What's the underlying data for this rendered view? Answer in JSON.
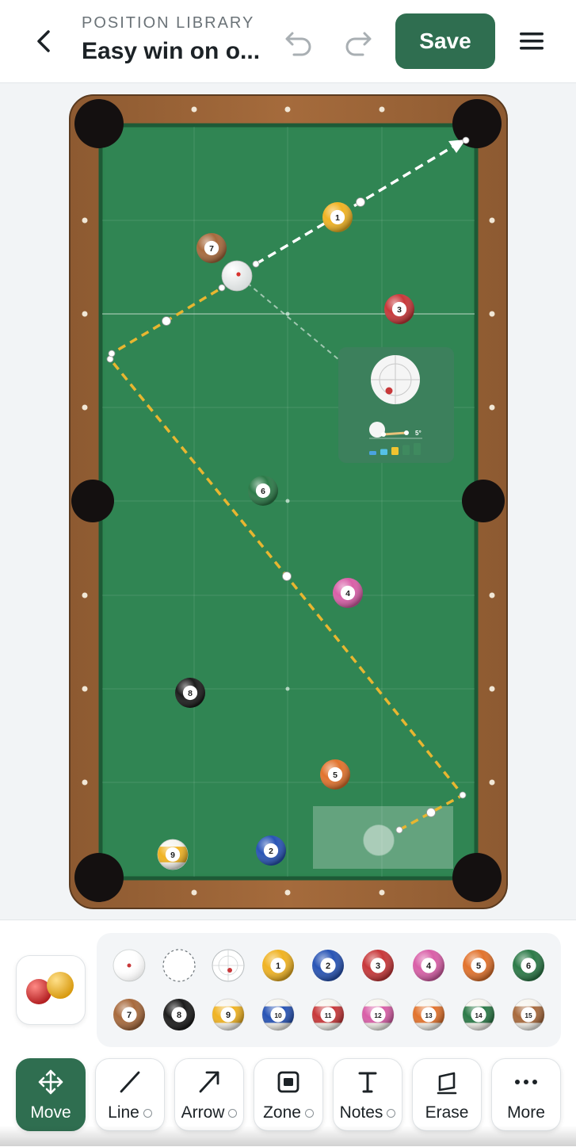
{
  "header": {
    "subtitle": "POSITION LIBRARY",
    "title": "Easy win on o...",
    "save_label": "Save",
    "back_icon": "chevron-left-icon",
    "undo_icon": "undo-icon",
    "redo_icon": "redo-icon",
    "menu_icon": "hamburger-menu-icon"
  },
  "colors": {
    "brand": "#2f6e50",
    "felt": "#2f8452",
    "rail": "#a0673a",
    "aim_line": "#e8b630",
    "cue_path": "#ffffff"
  },
  "table": {
    "balls": [
      {
        "number": "1",
        "color": "#f0b323",
        "stripe": false
      },
      {
        "number": "2",
        "color": "#2854b5",
        "stripe": false
      },
      {
        "number": "3",
        "color": "#c8383a",
        "stripe": false
      },
      {
        "number": "4",
        "color": "#d95fa8",
        "stripe": false
      },
      {
        "number": "5",
        "color": "#e2732d",
        "stripe": false
      },
      {
        "number": "6",
        "color": "#2c7a48",
        "stripe": false
      },
      {
        "number": "7",
        "color": "#a86a3d",
        "stripe": false
      },
      {
        "number": "8",
        "color": "#1c1c1c",
        "stripe": false
      },
      {
        "number": "9",
        "color": "#f0b323",
        "stripe": true
      }
    ],
    "spin_panel": {
      "angle_label": "5°",
      "level_colors": [
        "#4aa3df",
        "#55c1e8",
        "#f0c330",
        "#3f8a5f",
        "#3f8a5f"
      ]
    }
  },
  "palette": {
    "row1": [
      {
        "kind": "cue",
        "label": ""
      },
      {
        "kind": "ghost",
        "label": ""
      },
      {
        "kind": "target",
        "label": ""
      },
      {
        "kind": "solid",
        "label": "1",
        "color": "#f0b323"
      },
      {
        "kind": "solid",
        "label": "2",
        "color": "#2854b5"
      },
      {
        "kind": "solid",
        "label": "3",
        "color": "#c8383a"
      },
      {
        "kind": "solid",
        "label": "4",
        "color": "#d95fa8"
      },
      {
        "kind": "solid",
        "label": "5",
        "color": "#e2732d"
      },
      {
        "kind": "solid",
        "label": "6",
        "color": "#2c7a48"
      }
    ],
    "row2": [
      {
        "kind": "solid",
        "label": "7",
        "color": "#a86a3d"
      },
      {
        "kind": "solid",
        "label": "8",
        "color": "#1c1c1c"
      },
      {
        "kind": "stripe",
        "label": "9",
        "color": "#f0b323"
      },
      {
        "kind": "stripe",
        "label": "10",
        "color": "#2854b5"
      },
      {
        "kind": "stripe",
        "label": "11",
        "color": "#c8383a"
      },
      {
        "kind": "stripe",
        "label": "12",
        "color": "#d95fa8"
      },
      {
        "kind": "stripe",
        "label": "13",
        "color": "#e2732d"
      },
      {
        "kind": "stripe",
        "label": "14",
        "color": "#2c7a48"
      },
      {
        "kind": "stripe",
        "label": "15",
        "color": "#a86a3d"
      }
    ]
  },
  "tools": [
    {
      "label": "Move",
      "icon": "move-arrows-icon",
      "active": true,
      "options": false
    },
    {
      "label": "Line",
      "icon": "line-icon",
      "active": false,
      "options": true
    },
    {
      "label": "Arrow",
      "icon": "arrow-icon",
      "active": false,
      "options": true
    },
    {
      "label": "Zone",
      "icon": "zone-icon",
      "active": false,
      "options": true
    },
    {
      "label": "Notes",
      "icon": "text-icon",
      "active": false,
      "options": true
    },
    {
      "label": "Erase",
      "icon": "eraser-icon",
      "active": false,
      "options": false
    },
    {
      "label": "More",
      "icon": "more-dots-icon",
      "active": false,
      "options": false
    }
  ]
}
